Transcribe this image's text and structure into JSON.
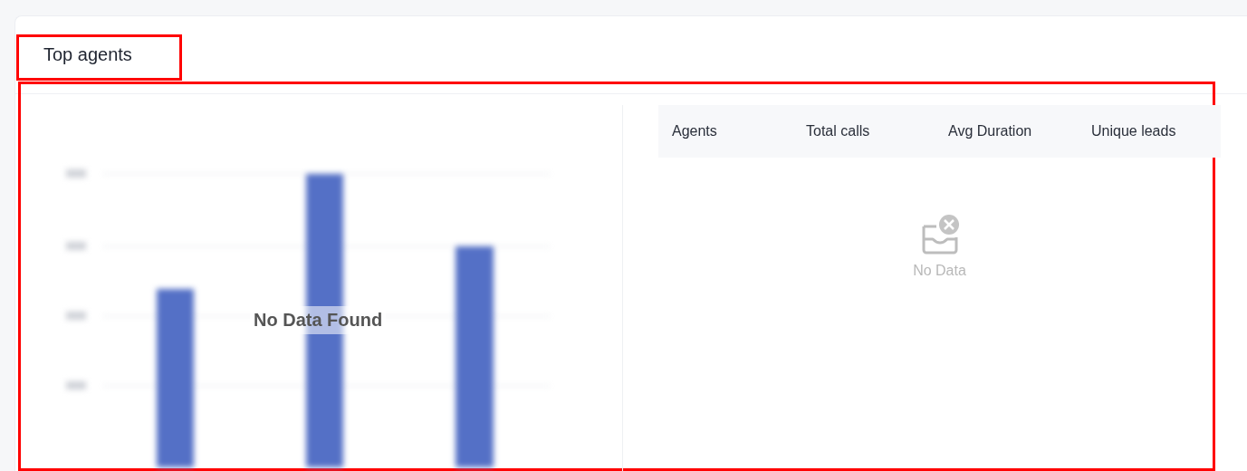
{
  "card": {
    "title": "Top agents"
  },
  "chart": {
    "overlay_text": "No Data Found"
  },
  "table": {
    "columns": [
      "Agents",
      "Total calls",
      "Avg Duration",
      "Unique leads"
    ],
    "empty_text": "No Data"
  }
}
